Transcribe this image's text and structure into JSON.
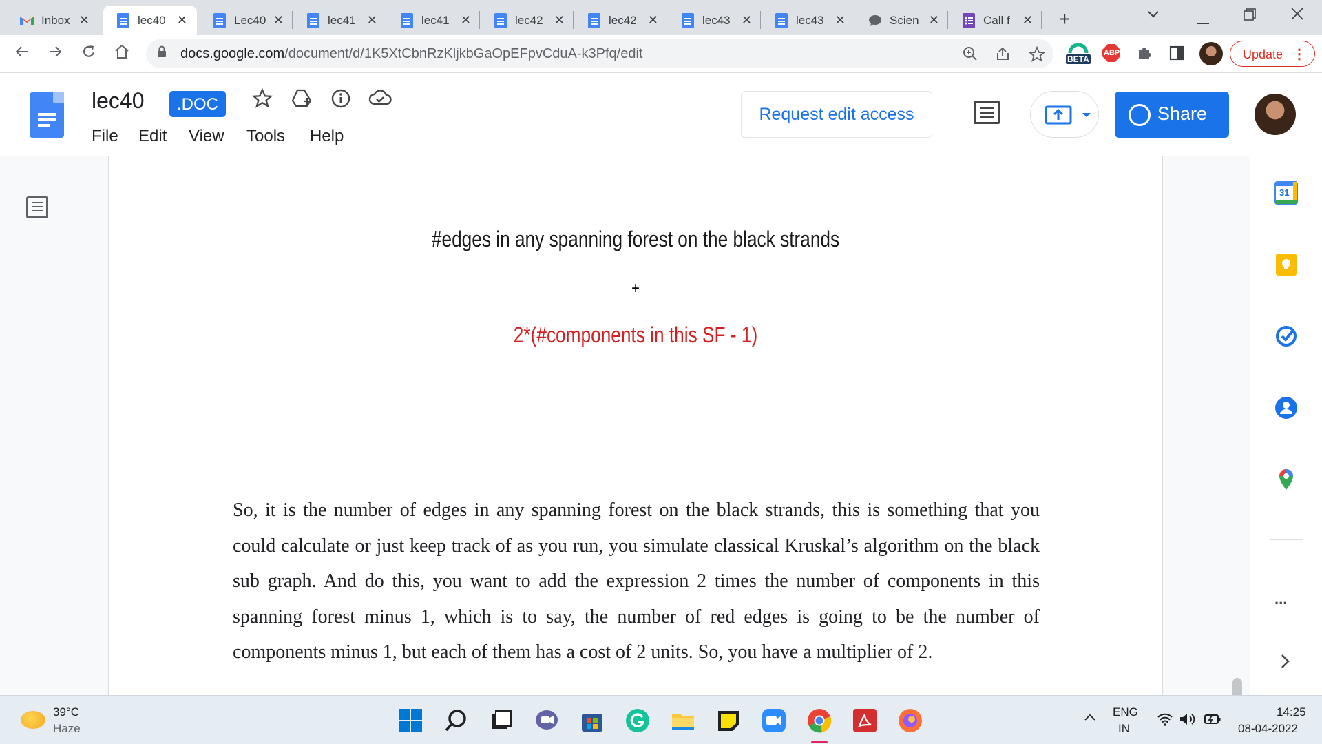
{
  "browser": {
    "tabs": [
      {
        "title": "Inbox",
        "type": "gmail"
      },
      {
        "title": "lec40",
        "type": "doc",
        "active": true
      },
      {
        "title": "Lec40",
        "type": "doc"
      },
      {
        "title": "lec41",
        "type": "doc"
      },
      {
        "title": "lec41",
        "type": "doc"
      },
      {
        "title": "lec42",
        "type": "doc"
      },
      {
        "title": "lec42",
        "type": "doc"
      },
      {
        "title": "lec43",
        "type": "doc"
      },
      {
        "title": "lec43",
        "type": "doc"
      },
      {
        "title": "Scien",
        "type": "chat"
      },
      {
        "title": "Call f",
        "type": "form"
      }
    ],
    "url_domain": "docs.google.com",
    "url_path": "/document/d/1K5XtCbnRzKljkbGaOpEFpvCduA-k3Pfq/edit",
    "update_label": "Update",
    "beta_label": "BETA",
    "abp_label": "ABP"
  },
  "docs": {
    "title": "lec40",
    "badge": ".DOC",
    "menu": [
      "File",
      "Edit",
      "View",
      "Tools",
      "Help"
    ],
    "request_edit_label": "Request edit access",
    "share_label": "Share",
    "accent": "#1a73e8"
  },
  "page": {
    "slide_line_1": "#edges in any spanning forest on the black strands",
    "slide_line_2": "+",
    "slide_line_3": "2*(#components in this SF - 1)",
    "slide_line_3_color": "#d42020",
    "body": "So, it is the number of edges in any spanning forest on the black strands, this is something that you could calculate or just keep track of as you run, you simulate classical Kruskal’s algorithm on the black sub graph. And do this, you want to add the expression 2 times the number of components in this spanning forest minus 1, which is to say, the number of red edges is going to be the number of components minus 1, but each of them has a cost of 2 units. So, you have a multiplier of 2."
  },
  "side_panel": {
    "calendar_day": "31",
    "more_label": "..."
  },
  "taskbar": {
    "weather_temp": "39°C",
    "weather_desc": "Haze",
    "lang_1": "ENG",
    "lang_2": "IN",
    "time": "14:25",
    "date": "08-04-2022"
  }
}
